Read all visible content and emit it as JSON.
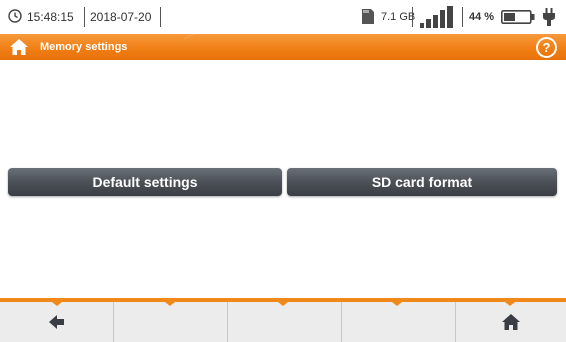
{
  "status": {
    "time": "15:48:15",
    "date": "2018-07-20",
    "storage": "7.1 GB",
    "battery_percent": "44 %",
    "battery_level": 0.44,
    "icons": [
      "clock-icon",
      "sd-card-icon",
      "signal-icon",
      "battery-icon",
      "plug-icon"
    ]
  },
  "title": {
    "text": "Memory settings",
    "help_glyph": "?"
  },
  "buttons": {
    "default_settings": "Default settings",
    "sd_card_format": "SD card format"
  },
  "bottom": {
    "back_icon": "back-arrow-icon",
    "home_icon": "home-icon"
  },
  "colors": {
    "accent": "#f0881a",
    "button": "#4c5158"
  }
}
